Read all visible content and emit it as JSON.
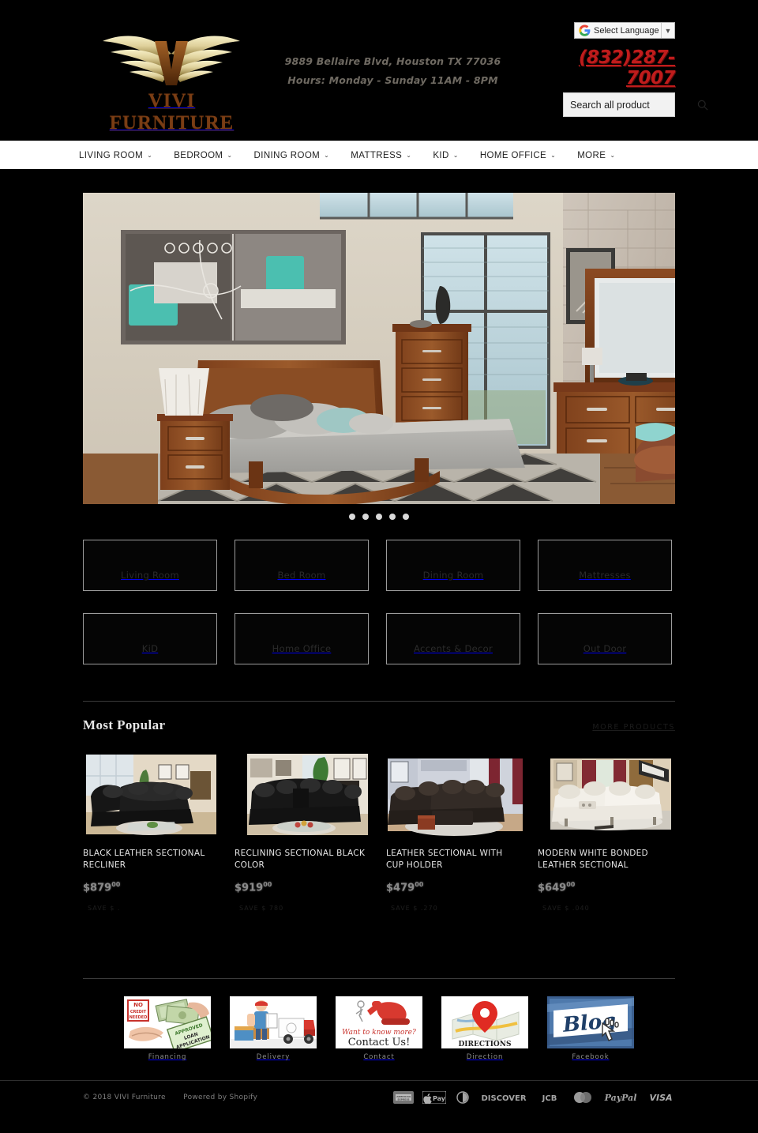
{
  "header": {
    "logo_word": "VIVI FURNITURE",
    "logo_mark": "wings-v-logo",
    "address": "9889 Bellaire Blvd, Houston TX 77036",
    "hours": "Hours: Monday - Sunday 11AM - 8PM",
    "phone": "(832)287-7007",
    "language": {
      "label": "Select Language",
      "icon": "google-g-icon",
      "arrow": "▼"
    },
    "search": {
      "placeholder": "Search all product",
      "value": "",
      "icon": "search-icon"
    }
  },
  "nav": {
    "items": [
      {
        "label": "LIVING ROOM",
        "caret": "⌄"
      },
      {
        "label": "BEDROOM",
        "caret": "⌄"
      },
      {
        "label": "DINING ROOM",
        "caret": "⌄"
      },
      {
        "label": "MATTRESS",
        "caret": "⌄"
      },
      {
        "label": "KID",
        "caret": "⌄"
      },
      {
        "label": "HOME OFFICE",
        "caret": "⌄"
      },
      {
        "label": "MORE",
        "caret": "⌄"
      }
    ]
  },
  "hero": {
    "alt": "bedroom-set-slide",
    "slide_count": 5,
    "active_slide": 1
  },
  "categories": [
    {
      "label": "Living Room"
    },
    {
      "label": "Bed Room"
    },
    {
      "label": "Dining Room"
    },
    {
      "label": "Mattresses"
    },
    {
      "label": "KiD"
    },
    {
      "label": "Home Office"
    },
    {
      "label": "Accents & Decor"
    },
    {
      "label": "Out Door"
    }
  ],
  "most_popular": {
    "title": "Most Popular",
    "more_label": "MORE PRODUCTS",
    "products": [
      {
        "name": "BLACK LEATHER SECTIONAL RECLINER",
        "price": "$879",
        "cents": "00",
        "sub": "SAVE $ ."
      },
      {
        "name": "RECLINING SECTIONAL BLACK COLOR",
        "price": "$919",
        "cents": "00",
        "sub": "SAVE $ 780"
      },
      {
        "name": "LEATHER SECTIONAL WITH CUP HOLDER",
        "price": "$479",
        "cents": "00",
        "sub": "SAVE $ .270"
      },
      {
        "name": "MODERN WHITE BONDED LEATHER SECTIONAL",
        "price": "$649",
        "cents": "00",
        "sub": "SAVE $ .040"
      }
    ]
  },
  "services": [
    {
      "label": "Financing",
      "icon": "financing-icon"
    },
    {
      "label": "Delivery",
      "icon": "delivery-truck-icon"
    },
    {
      "label": "Contact",
      "icon": "contact-phone-icon"
    },
    {
      "label": "Direction",
      "icon": "map-pin-icon"
    },
    {
      "label": "Facebook",
      "icon": "blog-icon"
    }
  ],
  "footer": {
    "copyright": "© 2018 VIVI Furniture",
    "powered_by": "Powered by Shopify",
    "payments": [
      "american-express",
      "apple-pay",
      "diners-club",
      "discover",
      "jcb",
      "mastercard",
      "paypal",
      "visa"
    ]
  },
  "colors": {
    "background": "#000000",
    "nav_bg": "#ffffff",
    "phone_red": "#c01c1c",
    "logo_brown": "#7a3d14",
    "logo_gold": "#e8d9a0"
  }
}
